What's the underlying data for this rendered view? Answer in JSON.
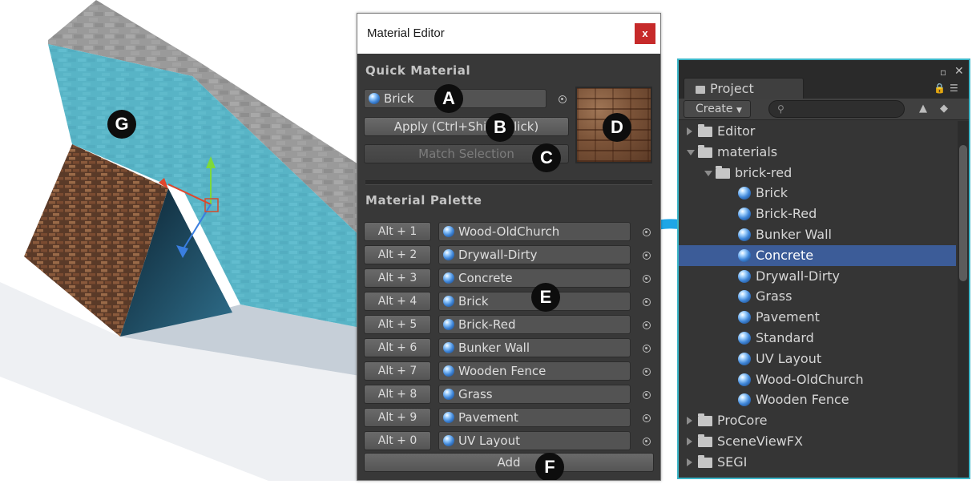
{
  "editor": {
    "title": "Material Editor",
    "close": "x",
    "quick_material": {
      "heading": "Quick Material",
      "current": "Brick",
      "apply_label": "Apply (Ctrl+Shift+Click)",
      "match_label": "Match Selection"
    },
    "palette": {
      "heading": "Material Palette",
      "rows": [
        {
          "shortcut": "Alt + 1",
          "material": "Wood-OldChurch"
        },
        {
          "shortcut": "Alt + 2",
          "material": "Drywall-Dirty"
        },
        {
          "shortcut": "Alt + 3",
          "material": "Concrete"
        },
        {
          "shortcut": "Alt + 4",
          "material": "Brick"
        },
        {
          "shortcut": "Alt + 5",
          "material": "Brick-Red"
        },
        {
          "shortcut": "Alt + 6",
          "material": "Bunker Wall"
        },
        {
          "shortcut": "Alt + 7",
          "material": "Wooden Fence"
        },
        {
          "shortcut": "Alt + 8",
          "material": "Grass"
        },
        {
          "shortcut": "Alt + 9",
          "material": "Pavement"
        },
        {
          "shortcut": "Alt + 0",
          "material": "UV Layout"
        }
      ],
      "add_label": "Add"
    }
  },
  "callouts": {
    "a": "A",
    "b": "B",
    "c": "C",
    "d": "D",
    "e": "E",
    "f": "F",
    "g": "G"
  },
  "project": {
    "tab": "Project",
    "create_label": "Create",
    "tree": [
      {
        "label": "Editor",
        "kind": "folder",
        "depth": 0,
        "expanded": false,
        "selected": false
      },
      {
        "label": "materials",
        "kind": "folder",
        "depth": 0,
        "expanded": true,
        "selected": false
      },
      {
        "label": "brick-red",
        "kind": "folder",
        "depth": 1,
        "expanded": true,
        "selected": false
      },
      {
        "label": "Brick",
        "kind": "material",
        "depth": 2,
        "selected": false
      },
      {
        "label": "Brick-Red",
        "kind": "material",
        "depth": 2,
        "selected": false
      },
      {
        "label": "Bunker Wall",
        "kind": "material",
        "depth": 2,
        "selected": false
      },
      {
        "label": "Concrete",
        "kind": "material",
        "depth": 2,
        "selected": true
      },
      {
        "label": "Drywall-Dirty",
        "kind": "material",
        "depth": 2,
        "selected": false
      },
      {
        "label": "Grass",
        "kind": "material",
        "depth": 2,
        "selected": false
      },
      {
        "label": "Pavement",
        "kind": "material",
        "depth": 2,
        "selected": false
      },
      {
        "label": "Standard",
        "kind": "material",
        "depth": 2,
        "selected": false
      },
      {
        "label": "UV Layout",
        "kind": "material",
        "depth": 2,
        "selected": false
      },
      {
        "label": "Wood-OldChurch",
        "kind": "material",
        "depth": 2,
        "selected": false
      },
      {
        "label": "Wooden Fence",
        "kind": "material",
        "depth": 2,
        "selected": false
      },
      {
        "label": "ProCore",
        "kind": "folder",
        "depth": 0,
        "expanded": false,
        "selected": false
      },
      {
        "label": "SceneViewFX",
        "kind": "folder",
        "depth": 0,
        "expanded": false,
        "selected": false
      },
      {
        "label": "SEGI",
        "kind": "folder",
        "depth": 0,
        "expanded": false,
        "selected": false
      }
    ]
  },
  "colors": {
    "accent": "#3cb6c8",
    "selection": "#3c5c98",
    "close": "#c62a2a",
    "drag_arrow": "#1ea6e6"
  }
}
